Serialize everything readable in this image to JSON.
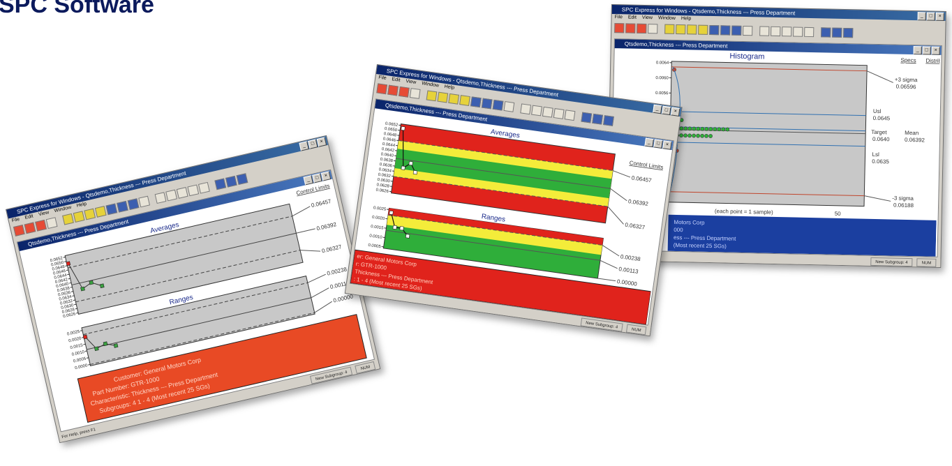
{
  "page": {
    "heading": "SPC Software"
  },
  "windows": {
    "left": {
      "app_title": "SPC Express for Windows - Qtsdemo,Thickness --- Press Department",
      "doc_title": "Qtsdemo,Thickness --- Press Department",
      "menu": [
        "File",
        "Edit",
        "View",
        "Window",
        "Help"
      ],
      "control_limits_label": "Control Limits",
      "averages_label": "Averages",
      "ranges_label": "Ranges",
      "avg_limits": [
        "0.06457",
        "0.06392",
        "0.06327"
      ],
      "range_limits": [
        "0.00238",
        "0.00113",
        "0.00000"
      ],
      "avg_ticks": [
        "0.0652",
        "0.0650",
        "0.0648",
        "0.0646",
        "0.0644",
        "0.0642",
        "0.0640",
        "0.0638",
        "0.0636",
        "0.0634",
        "0.0632",
        "0.0630",
        "0.0628",
        "0.0626"
      ],
      "range_ticks": [
        "0.0025",
        "0.0020",
        "0.0015",
        "0.0010",
        "0.0005",
        "0.0000"
      ],
      "info_lines": [
        "Customer: General Motors Corp",
        "Part Number: GTR-1000",
        "Characteristic: Thickness --- Press Department",
        "Subgroups: 4   1 - 4 (Most recent 25 SGs)"
      ],
      "status_subgroup": "New Subgroup: 4",
      "status_num": "NUM",
      "status_help": "For Help, press F1"
    },
    "middle": {
      "app_title": "SPC Express for Windows - Qtsdemo,Thickness --- Press Department",
      "doc_title": "Qtsdemo,Thickness --- Press Department",
      "menu": [
        "File",
        "Edit",
        "View",
        "Window",
        "Help"
      ],
      "control_limits_label": "Control Limits",
      "averages_label": "Averages",
      "ranges_label": "Ranges",
      "avg_limits": [
        "0.06457",
        "0.06392",
        "0.06327"
      ],
      "range_limits": [
        "0.00238",
        "0.00113",
        "0.00000"
      ],
      "avg_ticks": [
        "0.0652",
        "0.0650",
        "0.0648",
        "0.0646",
        "0.0644",
        "0.0642",
        "0.0640",
        "0.0638",
        "0.0636",
        "0.0634",
        "0.0632",
        "0.0630",
        "0.0628",
        "0.0626"
      ],
      "range_ticks": [
        "0.0025",
        "0.0020",
        "0.0015",
        "0.0010",
        "0.0005"
      ],
      "info_lines": [
        "er: General Motors Corp",
        "r: GTR-1000",
        "Thickness --- Press Department",
        ": 1 - 4 (Most recent 25 SGs)"
      ],
      "status_subgroup": "New Subgroup: 4",
      "status_num": "NUM"
    },
    "right": {
      "app_title": "SPC Express for Windows - Qtsdemo,Thickness --- Press Department",
      "doc_title": "Qtsdemo,Thickness --- Press Department",
      "menu": [
        "File",
        "Edit",
        "View",
        "Window",
        "Help"
      ],
      "histogram_label": "Histogram",
      "specs_label": "Specs",
      "distrib_label": "Distrib",
      "y_ticks": [
        "0.0064",
        "0.0060",
        "0.0056",
        "0.0052",
        "0.0048",
        "0.0044",
        "0.0040",
        "0.0036",
        "0.0032",
        "0.0028"
      ],
      "x_caption": "(each point = 1 sample)",
      "x_max": "50",
      "plus3_label": "+3 sigma",
      "plus3_value": "0.06596",
      "usl_label": "Usl",
      "usl_value": "0.0645",
      "target_label": "Target",
      "target_value": "0.0640",
      "mean_label": "Mean",
      "mean_value": "0.06392",
      "lsl_label": "Lsl",
      "lsl_value": "0.0635",
      "minus3_label": "-3 sigma",
      "minus3_value": "0.06188",
      "info_lines": [
        "Motors Corp",
        "000",
        "ess --- Press Department",
        "(Most recent 25 SGs)"
      ],
      "status_subgroup": "New Subgroup: 4",
      "status_num": "NUM"
    }
  },
  "colors": {
    "red_zone": "#e0231c",
    "yellow_zone": "#f4ec3a",
    "green_zone": "#2fae3a",
    "info_red": "#e84a25",
    "info_blue": "#1b3fa0",
    "plot_gray": "#c8c8c8"
  }
}
